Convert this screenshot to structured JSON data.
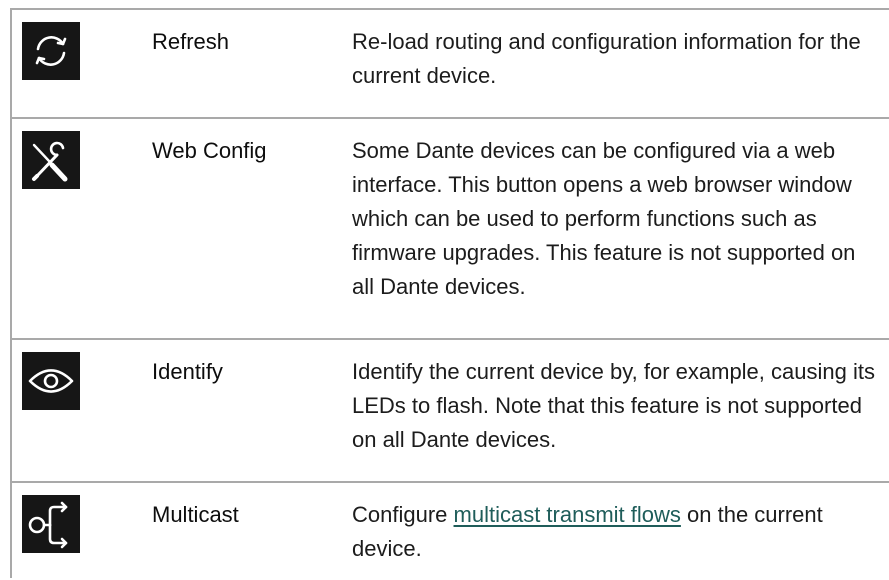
{
  "rows": [
    {
      "icon": "refresh-icon",
      "name": "Refresh",
      "description": "Re-load routing and configuration information for the current device."
    },
    {
      "icon": "web-config-tools-icon",
      "name": "Web Config",
      "description": "Some Dante devices can be configured via a web interface. This button opens a web browser window which can be used to perform functions such as firmware upgrades. This feature is not supported on all Dante devices."
    },
    {
      "icon": "eye-icon",
      "name": "Identify",
      "description": "Identify the current device by, for example, causing its LEDs to flash. Note that this feature is not supported on all Dante devices."
    },
    {
      "icon": "multicast-icon",
      "name": "Multicast",
      "description_before": "Configure ",
      "description_link": "multicast transmit flows",
      "description_after": " on the current device."
    }
  ],
  "colors": {
    "icon_background": "#161616",
    "icon_foreground": "#ffffff",
    "border": "#a9a9a9",
    "link": "#1f5d5a"
  }
}
